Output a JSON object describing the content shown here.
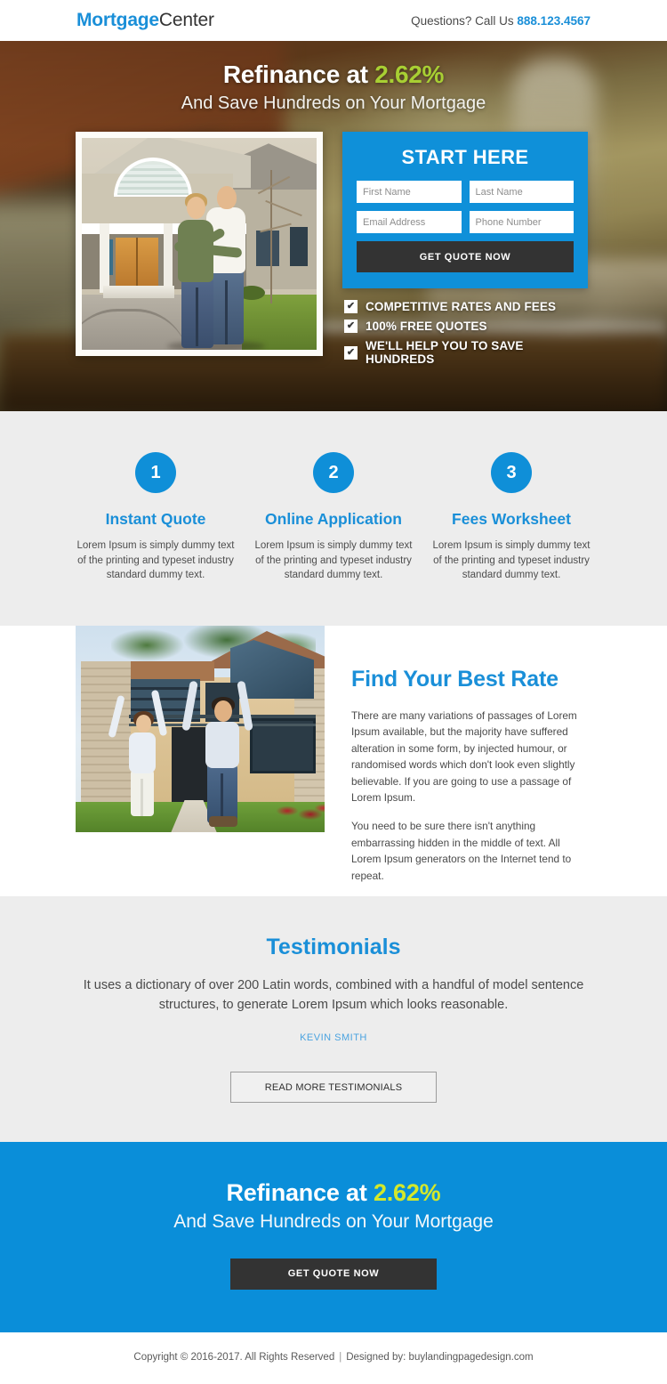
{
  "header": {
    "logo_primary": "Mortgage",
    "logo_secondary": "Center",
    "call_prefix": "Questions? Call Us ",
    "phone": "888.123.4567"
  },
  "hero": {
    "title_prefix": "Refinance at ",
    "title_rate": "2.62%",
    "subtitle": "And Save Hundreds on Your Mortgage",
    "form": {
      "title": "START HERE",
      "first_name_placeholder": "First Name",
      "last_name_placeholder": "Last Name",
      "email_placeholder": "Email Address",
      "phone_placeholder": "Phone Number",
      "submit_label": "GET QUOTE NOW"
    },
    "check_mark": "✔",
    "bullets": [
      "COMPETITIVE RATES AND FEES",
      "100% FREE QUOTES",
      "WE'LL HELP YOU TO SAVE HUNDREDS"
    ]
  },
  "steps": [
    {
      "number": "1",
      "title": "Instant Quote",
      "text": "Lorem Ipsum is simply dummy text of the printing and typeset industry standard dummy text."
    },
    {
      "number": "2",
      "title": "Online Application",
      "text": "Lorem Ipsum is simply dummy text of the printing and typeset industry standard dummy text."
    },
    {
      "number": "3",
      "title": "Fees Worksheet",
      "text": "Lorem Ipsum is simply dummy text of the printing and typeset industry standard dummy text."
    }
  ],
  "rate_section": {
    "heading": "Find Your Best Rate",
    "paragraph1": "There are many variations of passages of Lorem Ipsum available, but the majority have suffered alteration in some form, by injected humour, or randomised words which don't look even slightly believable. If you are going to use a passage of Lorem Ipsum.",
    "paragraph2": "You need to be sure there isn't anything embarrassing hidden in the middle of text. All Lorem Ipsum generators on the Internet tend to repeat."
  },
  "testimonials": {
    "heading": "Testimonials",
    "quote": "It uses a dictionary of over 200 Latin words, combined with a handful of model sentence structures, to generate Lorem Ipsum which looks reasonable.",
    "author": "KEVIN SMITH",
    "button_label": "READ MORE TESTIMONIALS"
  },
  "bottom_cta": {
    "title_prefix": "Refinance at ",
    "title_rate": "2.62%",
    "subtitle": "And Save Hundreds on Your Mortgage",
    "button_label": "GET QUOTE NOW"
  },
  "footer": {
    "copyright": "Copyright © 2016-2017. All Rights Reserved",
    "separator": "|",
    "credit": "Designed by: buylandingpagedesign.com"
  },
  "colors": {
    "brand_blue": "#1a8fd8",
    "form_blue": "#0f90d9",
    "cta_blue": "#0a8ed9",
    "hero_rate_green": "#a8cf33",
    "cta_rate_green": "#d4e82a",
    "dark_button": "#333333",
    "gray_section": "#ededed"
  }
}
